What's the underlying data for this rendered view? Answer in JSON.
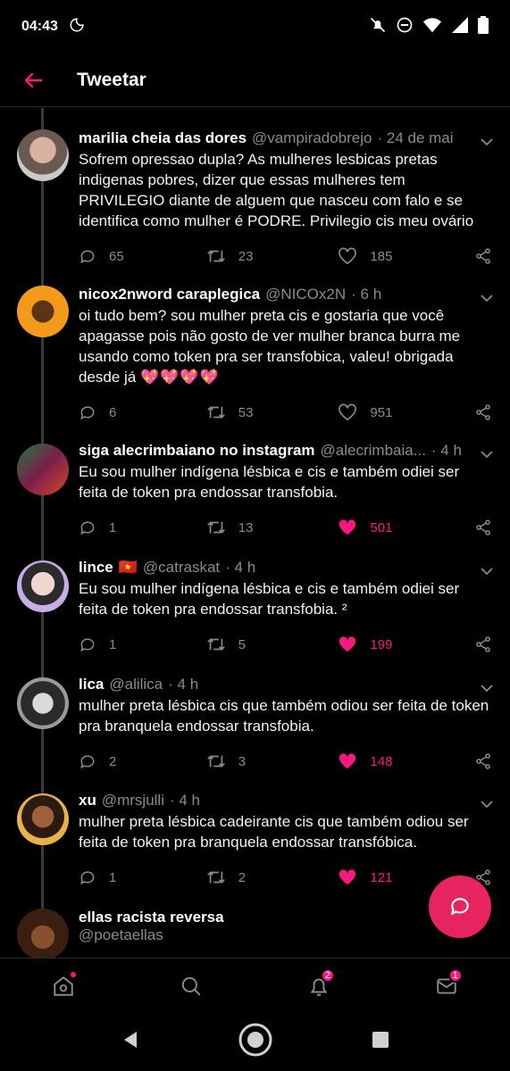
{
  "status_bar": {
    "time": "04:43"
  },
  "header": {
    "title": "Tweetar"
  },
  "tweets": [
    {
      "name": "marilia cheia das dores",
      "handle": "@vampiradobrejo",
      "time": "· 24 de mai",
      "text": "Sofrem opressao dupla? As mulheres lesbicas pretas indigenas pobres, dizer que essas mulheres tem PRIVILEGIO diante de alguem que nasceu com falo e se identifica como mulher é PODRE. Privilegio cis meu ovário",
      "replies": "65",
      "retweets": "23",
      "likes": "185",
      "liked": false
    },
    {
      "name": "nicox2nword caraplegica",
      "handle": "@NICOx2N",
      "time": "· 6 h",
      "text": "oi tudo bem? sou mulher preta cis e gostaria que você apagasse pois não gosto de ver mulher branca burra me usando como token pra ser transfobica, valeu! obrigada desde já",
      "emoji": "💖💖💖💖",
      "replies": "6",
      "retweets": "53",
      "likes": "951",
      "liked": false
    },
    {
      "name": "siga alecrimbaiano no instagram",
      "handle": "@alecrimbaia...",
      "time": "· 4 h",
      "text": "Eu sou mulher indígena lésbica e cis e também odiei ser feita de token pra endossar transfobia.",
      "replies": "1",
      "retweets": "13",
      "likes": "501",
      "liked": true
    },
    {
      "name": "lince",
      "flag": "🇻🇳",
      "handle": "@catraskat",
      "time": "· 4 h",
      "text": "Eu sou mulher indígena lésbica e cis e também odiei ser feita de token pra endossar transfobia. ²",
      "replies": "1",
      "retweets": "5",
      "likes": "199",
      "liked": true
    },
    {
      "name": "lica",
      "handle": "@alilica",
      "time": "· 4 h",
      "text": "mulher preta lésbica cis que também odiou ser feita de token pra branquela endossar transfobia.",
      "replies": "2",
      "retweets": "3",
      "likes": "148",
      "liked": true
    },
    {
      "name": "xu",
      "handle": "@mrsjulli",
      "time": "· 4 h",
      "text": "mulher preta lésbica cadeirante cis que também odiou ser feita de token pra branquela endossar transfóbica.",
      "replies": "1",
      "retweets": "2",
      "likes": "121",
      "liked": true
    },
    {
      "name": "ellas racista reversa",
      "handle": "@poetaellas"
    }
  ],
  "bottom_nav": {
    "notifications_badge": "2",
    "messages_badge": "1"
  },
  "colors": {
    "accent": "#f91880",
    "fab": "#e6245e",
    "background": "#000000",
    "muted": "#8b8b8b"
  }
}
